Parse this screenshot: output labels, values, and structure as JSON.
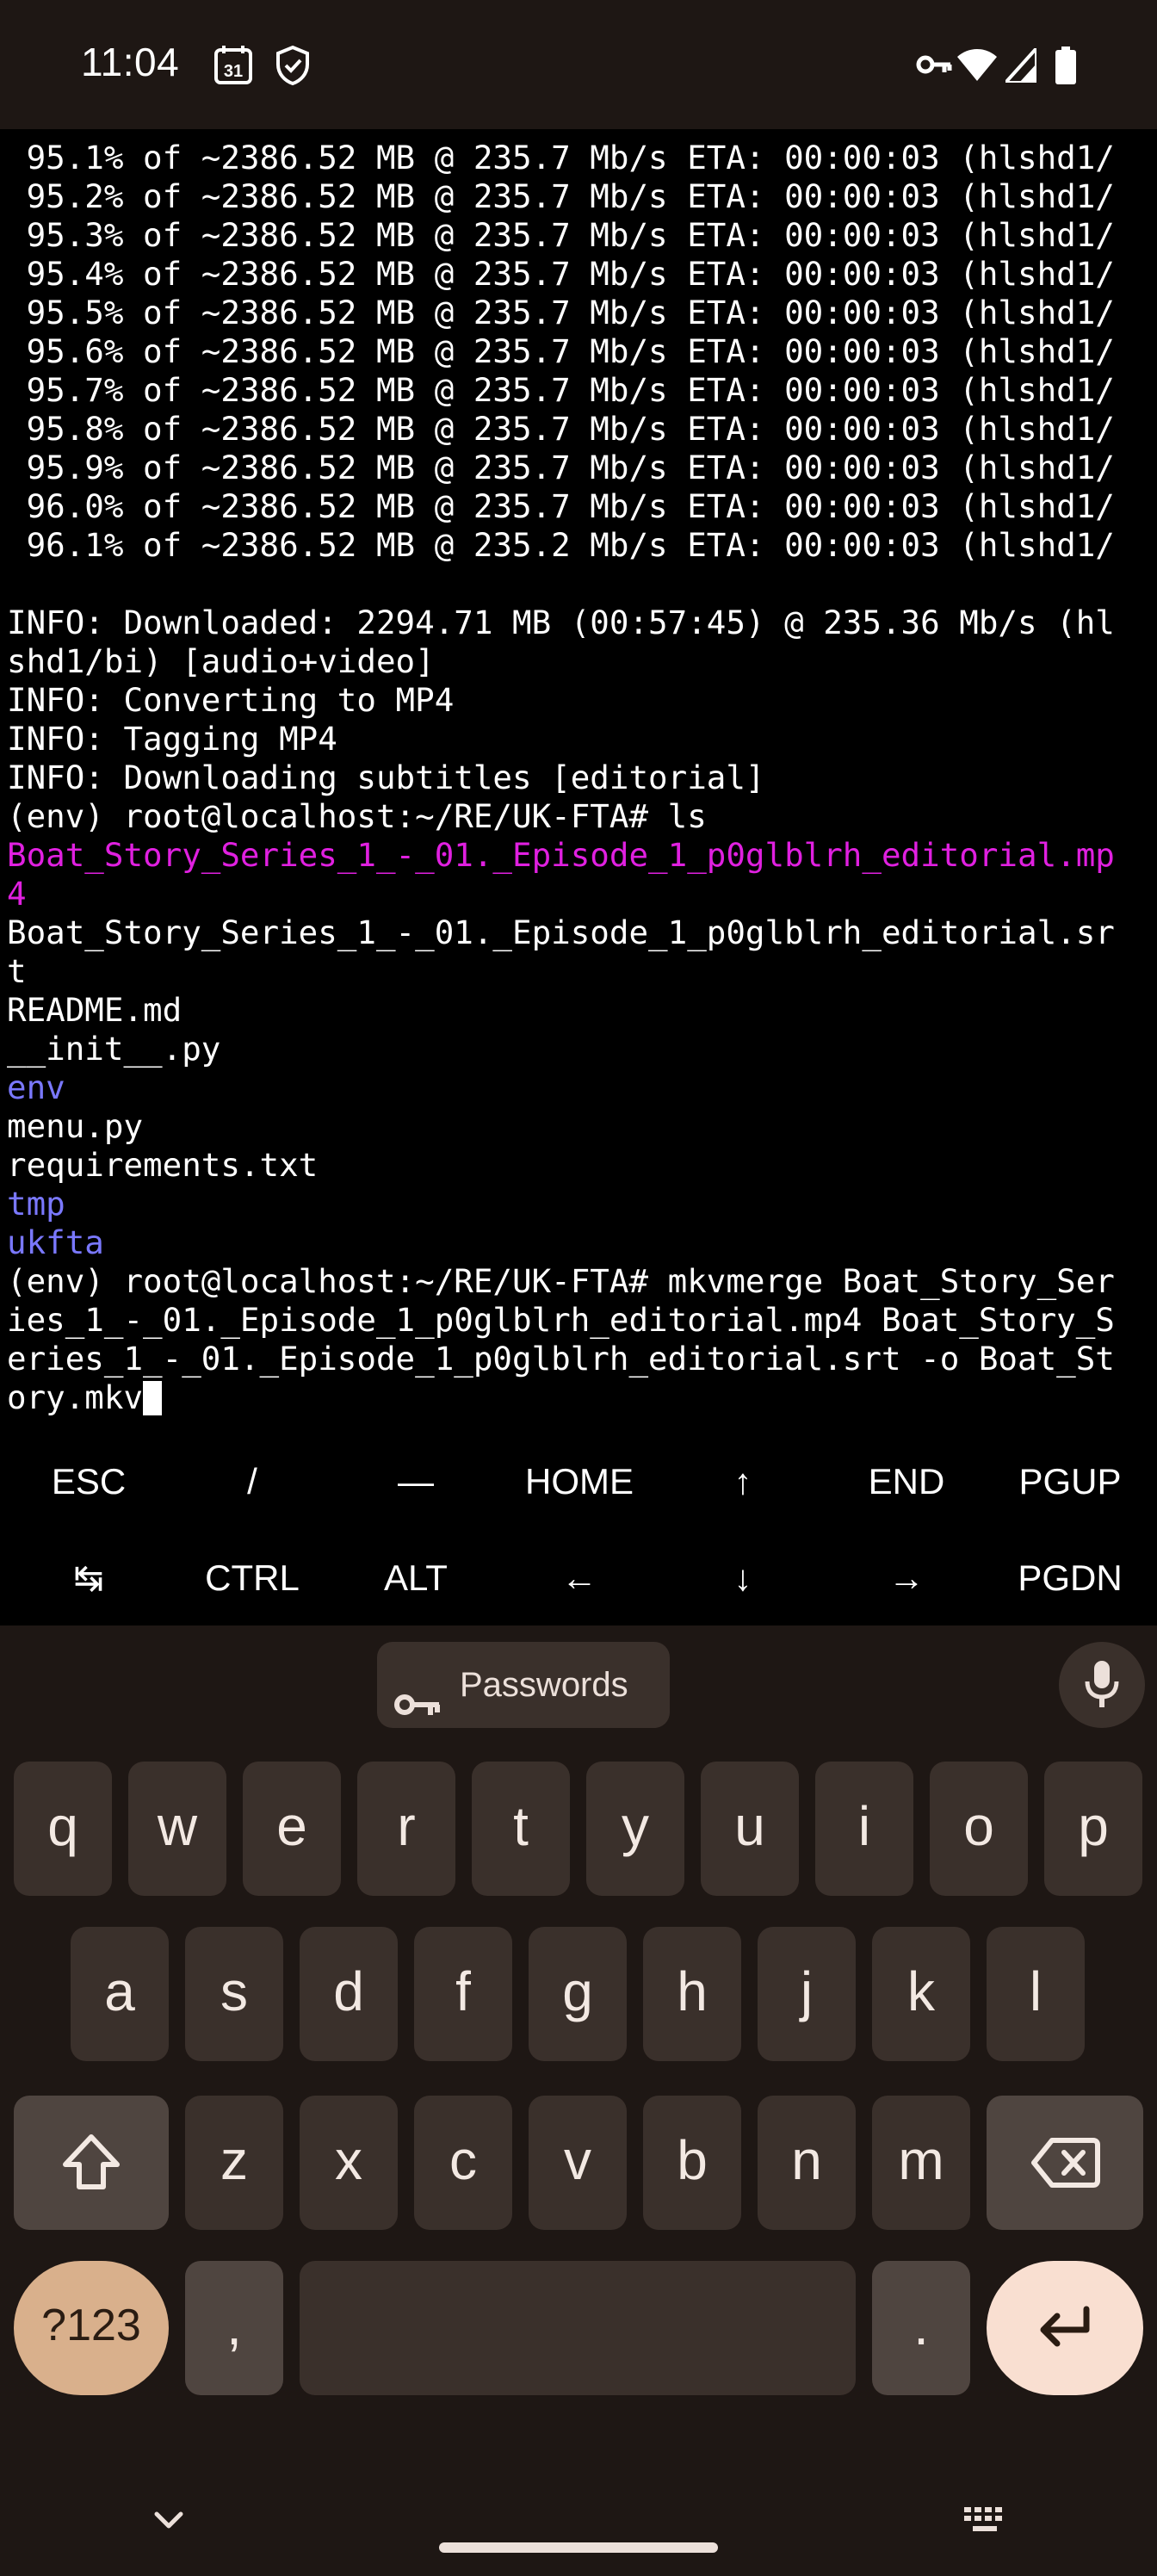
{
  "status_bar": {
    "time": "11:04",
    "calendar_day": "31",
    "icons": [
      "calendar-icon",
      "shield-icon",
      "vpn-key-icon",
      "wifi-icon",
      "signal-icon",
      "battery-icon"
    ]
  },
  "terminal": {
    "progress_lines": [
      " 95.1% of ~2386.52 MB @ 235.7 Mb/s ETA: 00:00:03 (hlshd1/",
      " 95.2% of ~2386.52 MB @ 235.7 Mb/s ETA: 00:00:03 (hlshd1/",
      " 95.3% of ~2386.52 MB @ 235.7 Mb/s ETA: 00:00:03 (hlshd1/",
      " 95.4% of ~2386.52 MB @ 235.7 Mb/s ETA: 00:00:03 (hlshd1/",
      " 95.5% of ~2386.52 MB @ 235.7 Mb/s ETA: 00:00:03 (hlshd1/",
      " 95.6% of ~2386.52 MB @ 235.7 Mb/s ETA: 00:00:03 (hlshd1/",
      " 95.7% of ~2386.52 MB @ 235.7 Mb/s ETA: 00:00:03 (hlshd1/",
      " 95.8% of ~2386.52 MB @ 235.7 Mb/s ETA: 00:00:03 (hlshd1/",
      " 95.9% of ~2386.52 MB @ 235.7 Mb/s ETA: 00:00:03 (hlshd1/",
      " 96.0% of ~2386.52 MB @ 235.7 Mb/s ETA: 00:00:03 (hlshd1/",
      " 96.1% of ~2386.52 MB @ 235.2 Mb/s ETA: 00:00:03 (hlshd1/"
    ],
    "info_lines": [
      "INFO: Downloaded: 2294.71 MB (00:57:45) @ 235.36 Mb/s (hl",
      "shd1/bi) [audio+video]",
      "INFO: Converting to MP4",
      "INFO: Tagging MP4",
      "INFO: Downloading subtitles [editorial]"
    ],
    "prompt_ls": "(env) root@localhost:~/RE/UK-FTA# ls",
    "ls_output": [
      {
        "text": "Boat_Story_Series_1_-_01._Episode_1_p0glblrh_editorial.mp",
        "kind": "mp4"
      },
      {
        "text": "4",
        "kind": "mp4"
      },
      {
        "text": "Boat_Story_Series_1_-_01._Episode_1_p0glblrh_editorial.sr",
        "kind": "file"
      },
      {
        "text": "t",
        "kind": "file"
      },
      {
        "text": "README.md",
        "kind": "file"
      },
      {
        "text": "__init__.py",
        "kind": "file"
      },
      {
        "text": "env",
        "kind": "dir"
      },
      {
        "text": "menu.py",
        "kind": "file"
      },
      {
        "text": "requirements.txt",
        "kind": "file"
      },
      {
        "text": "tmp",
        "kind": "dir"
      },
      {
        "text": "ukfta",
        "kind": "dir"
      }
    ],
    "command_lines": [
      "(env) root@localhost:~/RE/UK-FTA# mkvmerge Boat_Story_Ser",
      "ies_1_-_01._Episode_1_p0glblrh_editorial.mp4 Boat_Story_S",
      "eries_1_-_01._Episode_1_p0glblrh_editorial.srt -o Boat_St",
      "ory.mkv"
    ],
    "colors": {
      "mp4_file": "#e020e0",
      "directory": "#7a78ff",
      "text": "#ffffff"
    }
  },
  "extra_keys": {
    "row1": [
      "ESC",
      "/",
      "—",
      "HOME",
      "↑",
      "END",
      "PGUP"
    ],
    "row2": [
      "↹",
      "CTRL",
      "ALT",
      "←",
      "↓",
      "→",
      "PGDN"
    ]
  },
  "keyboard": {
    "suggestion_chip": "Passwords",
    "row1": [
      "q",
      "w",
      "e",
      "r",
      "t",
      "y",
      "u",
      "i",
      "o",
      "p"
    ],
    "row2": [
      "a",
      "s",
      "d",
      "f",
      "g",
      "h",
      "j",
      "k",
      "l"
    ],
    "row3": [
      "z",
      "x",
      "c",
      "v",
      "b",
      "n",
      "m"
    ],
    "symbols_key": "?123",
    "comma_key": ",",
    "period_key": "."
  }
}
